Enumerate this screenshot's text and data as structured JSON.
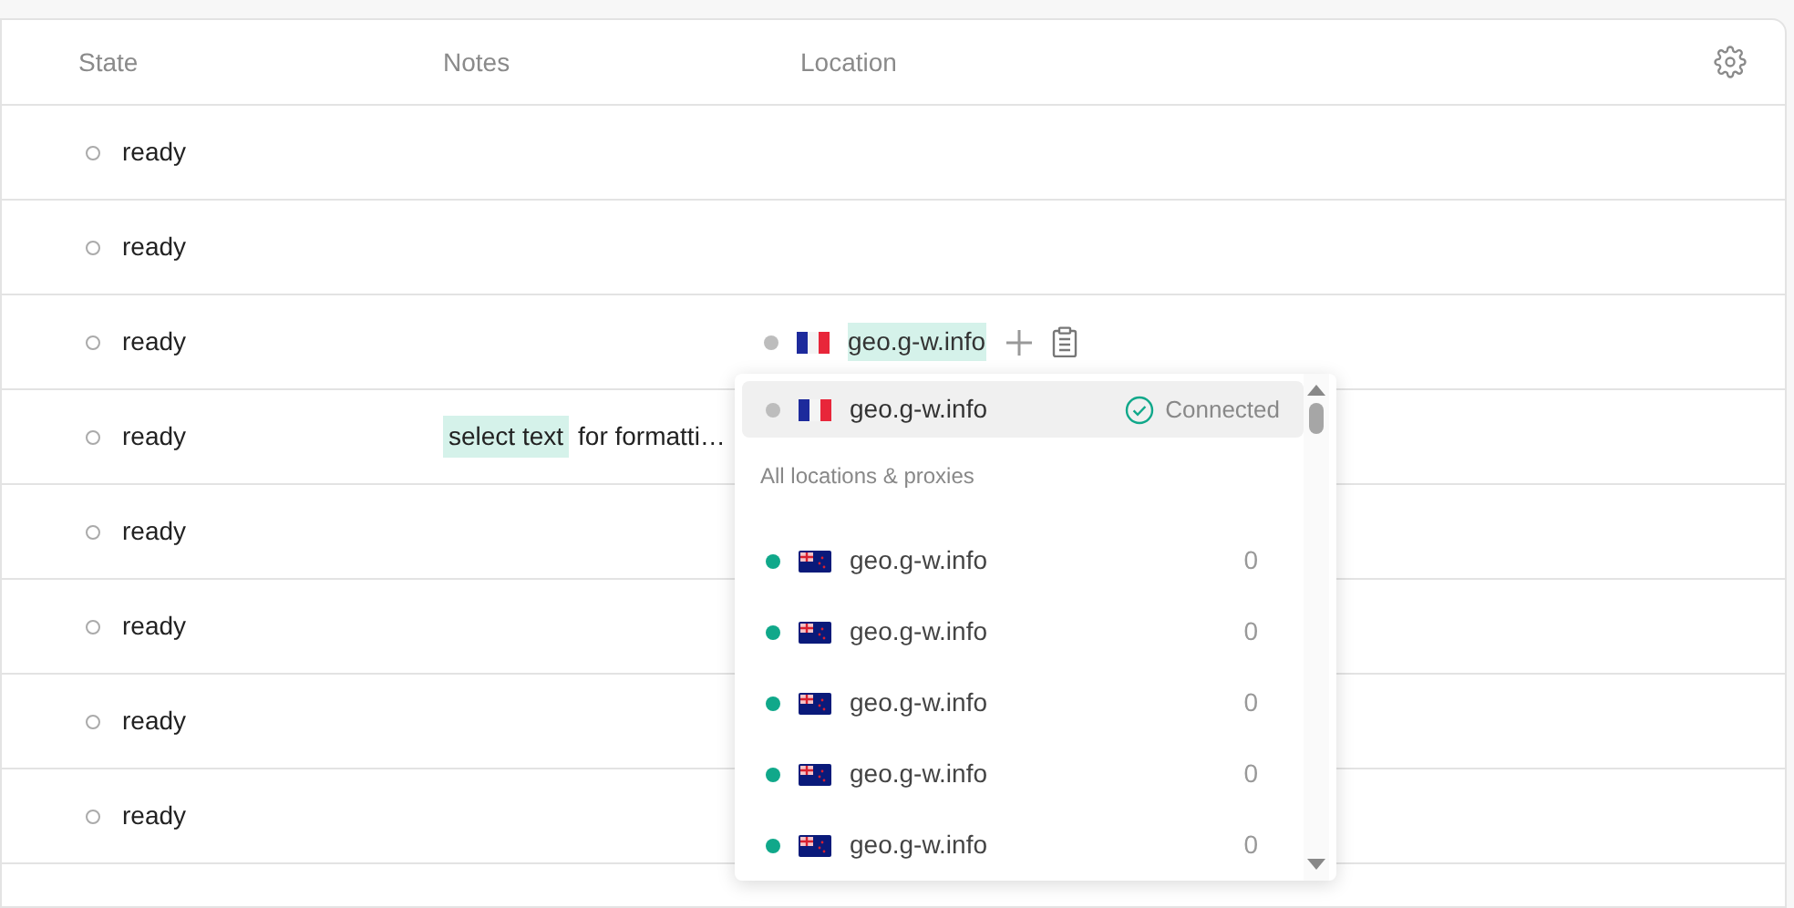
{
  "columns": [
    {
      "label": "State"
    },
    {
      "label": "Notes"
    },
    {
      "label": "Location"
    }
  ],
  "rows": [
    {
      "state": "ready"
    },
    {
      "state": "ready"
    },
    {
      "state": "ready",
      "location": {
        "host": "geo.g-w.info",
        "color": "#bdbdbd"
      }
    },
    {
      "state": "ready",
      "notes": {
        "highlight": "select text",
        "text": "for formatti…"
      }
    },
    {
      "state": "ready"
    },
    {
      "state": "ready"
    },
    {
      "state": "ready"
    },
    {
      "state": "ready"
    }
  ],
  "dropdown": {
    "current": {
      "host": "geo.g-w.info",
      "color": "#bdbdbd",
      "status": "Connected",
      "selected": true
    },
    "section_title": "All locations & proxies",
    "items": [
      {
        "host": "geo.g-w.info",
        "color": "#10a88a",
        "count": "0"
      },
      {
        "host": "geo.g-w.info",
        "color": "#10a88a",
        "count": "0"
      },
      {
        "host": "geo.g-w.info",
        "color": "#10a88a",
        "count": "0"
      },
      {
        "host": "geo.g-w.info",
        "color": "#10a88a",
        "count": "0"
      },
      {
        "host": "geo.g-w.info",
        "color": "#10a88a",
        "count": "0"
      }
    ]
  }
}
